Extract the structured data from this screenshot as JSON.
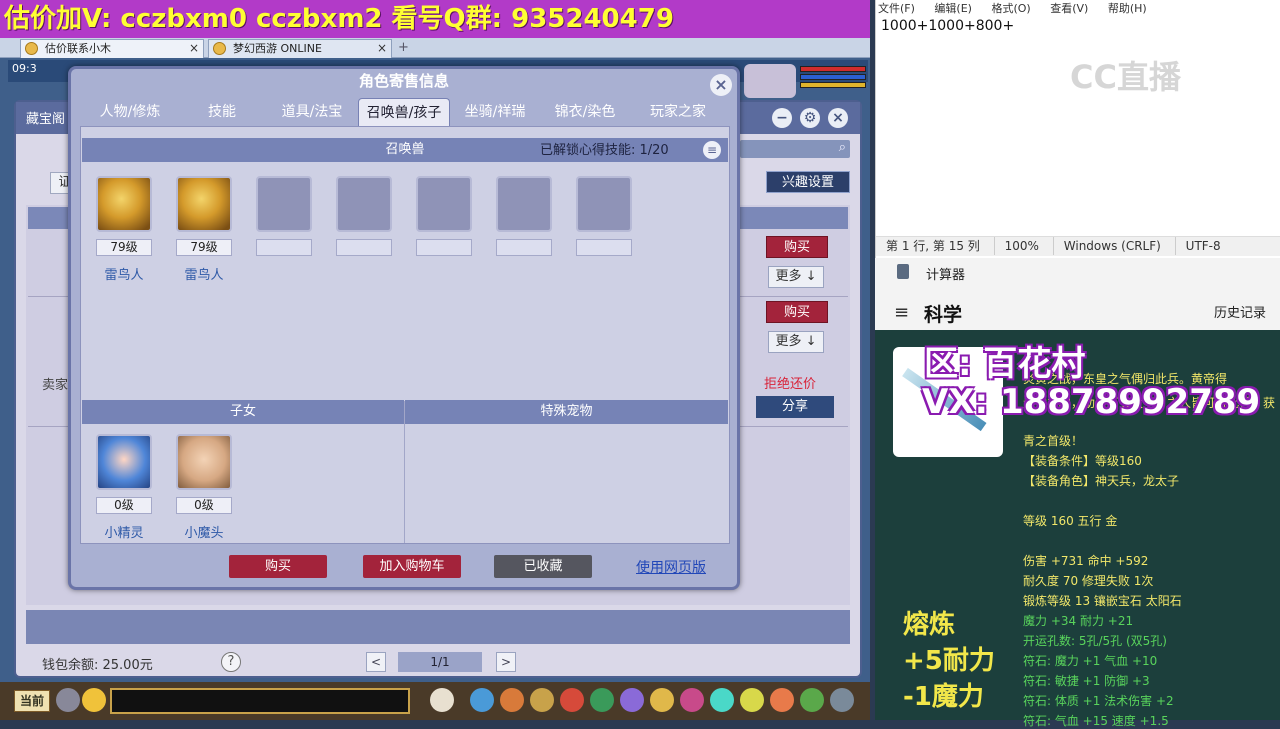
{
  "banner": {
    "text": "估价加V:  cczbxm0   cczbxm2   看号Q群: 935240479"
  },
  "browser_tabs": [
    {
      "label": "估价联系小木",
      "close": "×"
    },
    {
      "label": "梦幻西游 ONLINE",
      "close": "×"
    }
  ],
  "new_tab": "+",
  "game": {
    "clock": "09:3",
    "bg_window_title": "藏宝阁",
    "bg_filter_label": "证",
    "interest_button": "兴趣设置",
    "buy_label": "购买",
    "more_label": "更多 ↓",
    "refuse_bargain": "拒绝还价",
    "share_label": "分享",
    "seller_label": "卖家",
    "wallet": "钱包余额: 25.00元",
    "help": "?",
    "page_prev": "<",
    "page_info": "1/1",
    "page_next": ">",
    "bottom_current": "当前",
    "controls": {
      "minimize": "−",
      "settings": "⚙",
      "close": "×"
    }
  },
  "modal": {
    "title": "角色寄售信息",
    "close": "×",
    "tabs": [
      {
        "label": "人物/修炼"
      },
      {
        "label": "技能"
      },
      {
        "label": "道具/法宝"
      },
      {
        "label": "召唤兽/孩子",
        "active": true
      },
      {
        "label": "坐骑/祥瑞"
      },
      {
        "label": "锦衣/染色"
      },
      {
        "label": "玩家之家"
      }
    ],
    "summon_header": "召唤兽",
    "skill_unlock": "已解锁心得技能:  1/20",
    "skill_menu_icon": "≡",
    "pets": [
      {
        "level": "79级",
        "name": "雷鸟人"
      },
      {
        "level": "79级",
        "name": "雷鸟人"
      },
      {
        "level": "",
        "name": ""
      },
      {
        "level": "",
        "name": ""
      },
      {
        "level": "",
        "name": ""
      },
      {
        "level": "",
        "name": ""
      },
      {
        "level": "",
        "name": ""
      }
    ],
    "children_header": "子女",
    "special_header": "特殊宠物",
    "children": [
      {
        "level": "0级",
        "name": "小精灵"
      },
      {
        "level": "0级",
        "name": "小魔头"
      }
    ],
    "actions": {
      "buy": "购买",
      "add_cart": "加入购物车",
      "collected": "已收藏",
      "web_buy": "使用网页版"
    },
    "colors": {
      "buy": "#a3233b",
      "cart": "#a3233b",
      "collected": "#55565f"
    }
  },
  "notepad": {
    "menu": [
      "文件(F)",
      "编辑(E)",
      "格式(O)",
      "查看(V)",
      "帮助(H)"
    ],
    "content": "1000+1000+800+",
    "status": [
      "第 1 行, 第 15 列",
      "100%",
      "Windows (CRLF)",
      "UTF-8"
    ],
    "watermark": "CC直播"
  },
  "calculator": {
    "title": "计算器",
    "menu_icon": "≡",
    "mode": "科学",
    "history": "历史记录"
  },
  "item_panel": {
    "region": "区: 百花村",
    "vx": "VX: 18878992789",
    "lines": [
      {
        "text": "炎黄之战，东皇之气偶归此兵。黄帝得",
        "style": "y"
      },
      {
        "text": "蚩尤之利，助天下安太平，之人皆可持此兵，获",
        "style": "y"
      },
      {
        "text": "青之首级！",
        "style": "y"
      },
      {
        "text": "【装备条件】等级160",
        "style": "y"
      },
      {
        "text": "【装备角色】神天兵，龙太子",
        "style": "y"
      },
      {
        "text": "",
        "style": "y"
      },
      {
        "text": "等级 160 五行 金",
        "style": "y"
      },
      {
        "text": "",
        "style": "y"
      },
      {
        "text": "伤害 +731 命中 +592",
        "style": "y"
      },
      {
        "text": "耐久度 70 修理失败 1次",
        "style": "y"
      },
      {
        "text": "锻炼等级 13 镶嵌宝石 太阳石",
        "style": "y"
      },
      {
        "text": "魔力 +34 耐力 +21",
        "style": "g"
      },
      {
        "text": "开运孔数: 5孔/5孔 (双5孔)",
        "style": "g"
      },
      {
        "text": "符石: 魔力 +1 气血 +10",
        "style": "g"
      },
      {
        "text": "符石: 敏捷 +1 防御 +3",
        "style": "g"
      },
      {
        "text": "符石: 体质 +1 法术伤害 +2",
        "style": "g"
      },
      {
        "text": "符石: 气血 +15 速度 +1.5",
        "style": "g"
      }
    ],
    "side_notes": [
      "熔炼",
      "+5耐力",
      "-1魔力"
    ]
  }
}
